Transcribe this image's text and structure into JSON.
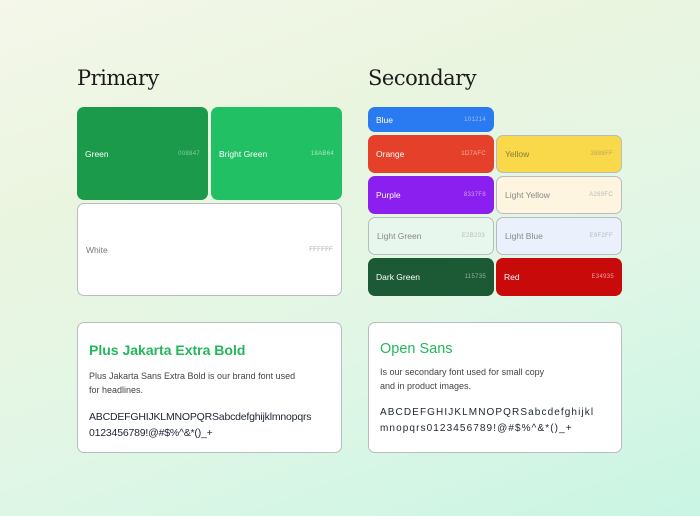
{
  "primary": {
    "title": "Primary",
    "swatches": [
      {
        "name": "Green",
        "code": "008847",
        "color": "#1a9a4a"
      },
      {
        "name": "Bright Green",
        "code": "18AB64",
        "color": "#22c064"
      },
      {
        "name": "White",
        "code": "FFFFFF",
        "color": "#ffffff"
      }
    ]
  },
  "secondary": {
    "title": "Secondary",
    "swatches": [
      {
        "name": "Blue",
        "code": "101214",
        "color": "#2a7af2"
      },
      {
        "name": "Orange",
        "code": "1D7AFC",
        "color": "#e5402a"
      },
      {
        "name": "Yellow",
        "code": "3888FF",
        "color": "#f9d84a"
      },
      {
        "name": "Purple",
        "code": "8337F8",
        "color": "#8a1ff0"
      },
      {
        "name": "Light Yellow",
        "code": "A269FC",
        "color": "#fdf5e0"
      },
      {
        "name": "Light Green",
        "code": "E2B203",
        "color": "#e8f7ee"
      },
      {
        "name": "Light Blue",
        "code": "E9F2FF",
        "color": "#eaf0fc"
      },
      {
        "name": "Dark Green",
        "code": "115735",
        "color": "#1b5a34"
      },
      {
        "name": "Red",
        "code": "E34935",
        "color": "#c80a0a"
      }
    ]
  },
  "fonts": {
    "primary": {
      "heading": "Plus Jakarta Extra Bold",
      "description_line1": "Plus Jakarta Sans Extra Bold is our brand font used",
      "description_line2": "for headlines.",
      "glyphs_line1": "ABCDEFGHIJKLMNOPQRSabcdefghijklmnopqrs",
      "glyphs_line2": "0123456789!@#$%^&*()_+"
    },
    "secondary": {
      "heading": "Open Sans",
      "description_line1": "Is our secondary font used for small copy",
      "description_line2": "and in product images.",
      "glyphs_line1": "ABCDEFGHIJKLMNOPQRSabcdefghijkl",
      "glyphs_line2": "mnopqrs0123456789!@#$%^&*()_+"
    }
  },
  "accent_color": "#22b85a"
}
